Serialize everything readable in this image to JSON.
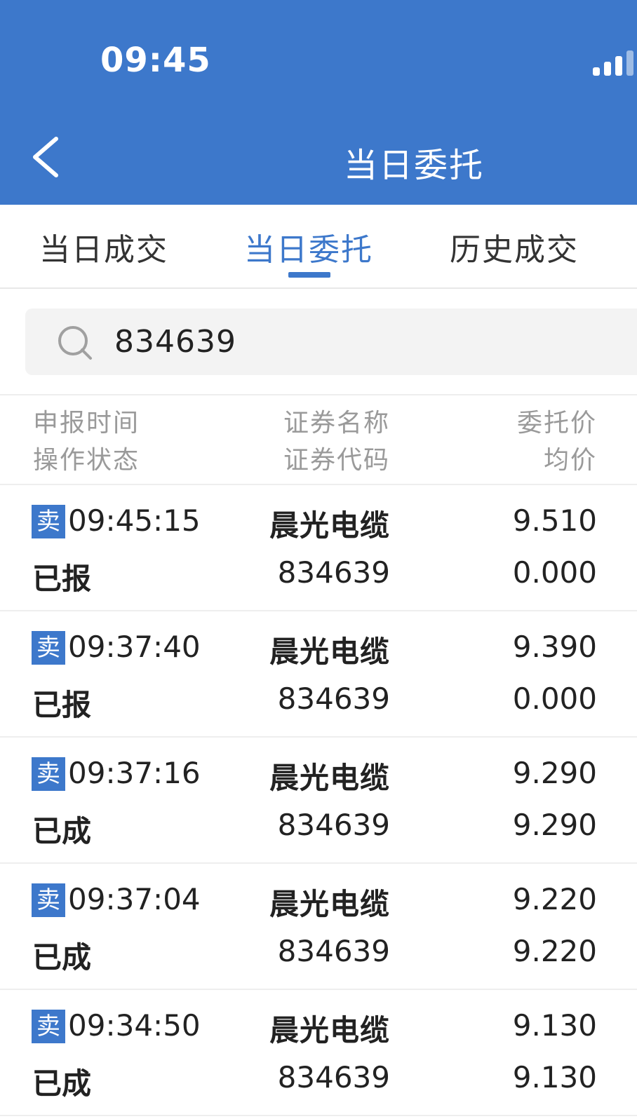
{
  "status_bar": {
    "time": "09:45"
  },
  "nav": {
    "title": "当日委托"
  },
  "tabs": [
    {
      "label": "当日成交"
    },
    {
      "label": "当日委托"
    },
    {
      "label": "历史成交"
    }
  ],
  "search": {
    "value": "834639"
  },
  "columns": {
    "time": "申报时间",
    "state": "操作状态",
    "name": "证券名称",
    "code": "证券代码",
    "price": "委托价",
    "avg": "均价"
  },
  "orders": [
    {
      "side": "卖",
      "time": "09:45:15",
      "status": "已报",
      "name": "晨光电缆",
      "code": "834639",
      "price": "9.510",
      "avg": "0.000"
    },
    {
      "side": "卖",
      "time": "09:37:40",
      "status": "已报",
      "name": "晨光电缆",
      "code": "834639",
      "price": "9.390",
      "avg": "0.000"
    },
    {
      "side": "卖",
      "time": "09:37:16",
      "status": "已成",
      "name": "晨光电缆",
      "code": "834639",
      "price": "9.290",
      "avg": "9.290"
    },
    {
      "side": "卖",
      "time": "09:37:04",
      "status": "已成",
      "name": "晨光电缆",
      "code": "834639",
      "price": "9.220",
      "avg": "9.220"
    },
    {
      "side": "卖",
      "time": "09:34:50",
      "status": "已成",
      "name": "晨光电缆",
      "code": "834639",
      "price": "9.130",
      "avg": "9.130"
    }
  ],
  "colors": {
    "accent": "#3d78cb",
    "header_bg": "#3d78cb",
    "search_bg": "#f3f3f3"
  }
}
